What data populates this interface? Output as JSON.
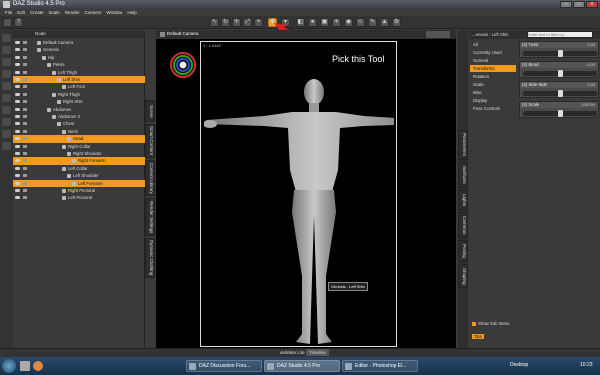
{
  "window": {
    "title": "DAZ Studio 4.5 Pro"
  },
  "menubar": [
    "File",
    "Edit",
    "Create",
    "Scale",
    "Render",
    "Connect",
    "Window",
    "Help"
  ],
  "scene_panel": {
    "header": "Node",
    "rows": [
      {
        "label": "Default Camera",
        "indent": 0,
        "selected": false
      },
      {
        "label": "Genesis",
        "indent": 0,
        "selected": false
      },
      {
        "label": "Hip",
        "indent": 1,
        "selected": false
      },
      {
        "label": "Pelvis",
        "indent": 2,
        "selected": false
      },
      {
        "label": "Left Thigh",
        "indent": 3,
        "selected": false
      },
      {
        "label": "Left Shin",
        "indent": 4,
        "selected": true
      },
      {
        "label": "Left Foot",
        "indent": 5,
        "selected": false
      },
      {
        "label": "Right Thigh",
        "indent": 3,
        "selected": false
      },
      {
        "label": "Right Shin",
        "indent": 4,
        "selected": false
      },
      {
        "label": "Abdomen",
        "indent": 2,
        "selected": false
      },
      {
        "label": "Abdomen 2",
        "indent": 3,
        "selected": false
      },
      {
        "label": "Chest",
        "indent": 4,
        "selected": false
      },
      {
        "label": "Neck",
        "indent": 5,
        "selected": false
      },
      {
        "label": "Head",
        "indent": 6,
        "selected": true
      },
      {
        "label": "Right Collar",
        "indent": 5,
        "selected": false
      },
      {
        "label": "Right Shoulder",
        "indent": 6,
        "selected": false
      },
      {
        "label": "Right Forearm",
        "indent": 7,
        "selected": true
      },
      {
        "label": "Left Collar",
        "indent": 5,
        "selected": false
      },
      {
        "label": "Left Shoulder",
        "indent": 6,
        "selected": false
      },
      {
        "label": "Left Forearm",
        "indent": 7,
        "selected": true
      },
      {
        "label": "Right Pectoral",
        "indent": 5,
        "selected": false
      },
      {
        "label": "Left Pectoral",
        "indent": 5,
        "selected": false
      }
    ]
  },
  "left_vtabs": [
    "Scene",
    "Smart Content",
    "Content Library",
    "Render Settings",
    "Dynamic Clothing"
  ],
  "viewport": {
    "camera": "Default Camera",
    "frame_label": "1 : 1.4142",
    "tooltip": "Genesis : Left Shin",
    "annotation": "Pick this Tool"
  },
  "right_vtabs": [
    "Parameters",
    "Surfaces",
    "Lights",
    "Cameras",
    "Posing",
    "Shaping"
  ],
  "parameters": {
    "node_label": "...enesis : Left Shin",
    "search_placeholder": "Enter text to filter by...",
    "categories": [
      {
        "label": "All",
        "selected": false
      },
      {
        "label": "Currently Used",
        "selected": false
      },
      {
        "label": "General",
        "selected": false
      },
      {
        "label": "Transforms",
        "selected": true
      },
      {
        "label": "Rotation",
        "selected": false
      },
      {
        "label": "Scale",
        "selected": false
      },
      {
        "label": "Misc",
        "selected": false
      },
      {
        "label": "Display",
        "selected": false
      },
      {
        "label": "Pose Controls",
        "selected": false
      }
    ],
    "sliders": [
      {
        "label": "(4) Twist",
        "value": "0.00",
        "fraction": 0.5
      },
      {
        "label": "(4) Bend",
        "value": "0.00",
        "fraction": 0.5
      },
      {
        "label": "(4) Side-Side",
        "value": "0.00",
        "fraction": 0.5
      },
      {
        "label": "(4) Scale",
        "value": "100.0%",
        "fraction": 0.5
      }
    ],
    "show_sub_items": "Show Sub Items",
    "tips": "Tips"
  },
  "bottom_tabs": [
    "aniMate Lite",
    "Timeline"
  ],
  "taskbar": {
    "items": [
      "DAZ Discussion Foru...",
      "DAZ Studio 4.5 Pro",
      "Editor - Photoshop El..."
    ],
    "desktop": "Desktop",
    "clock": "10:23"
  },
  "colors": {
    "accent": "#f29a1e",
    "selected_tool": "#f0a030",
    "annotation_arrow": "#e02020"
  }
}
